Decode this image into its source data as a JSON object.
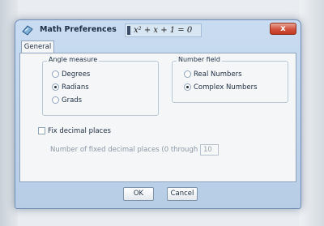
{
  "window": {
    "title": "Math Preferences",
    "formula": "x² + x + 1 = 0",
    "close_label": "x"
  },
  "tabs": [
    {
      "label": "General",
      "active": true
    }
  ],
  "angle_measure": {
    "label": "Angle measure",
    "options": [
      {
        "label": "Degrees",
        "selected": false
      },
      {
        "label": "Radians",
        "selected": true
      },
      {
        "label": "Grads",
        "selected": false
      }
    ]
  },
  "number_field": {
    "label": "Number field",
    "options": [
      {
        "label": "Real Numbers",
        "selected": false
      },
      {
        "label": "Complex Numbers",
        "selected": true
      }
    ]
  },
  "fix_decimal": {
    "label": "Fix decimal places",
    "checked": false,
    "count_label": "Number of fixed decimal places (0 through 13):",
    "count_value": "10"
  },
  "buttons": {
    "ok": "OK",
    "cancel": "Cancel"
  },
  "colors": {
    "title_bar": "#c9dcf1",
    "close_button": "#d2523d",
    "panel": "#f4f6f8"
  }
}
